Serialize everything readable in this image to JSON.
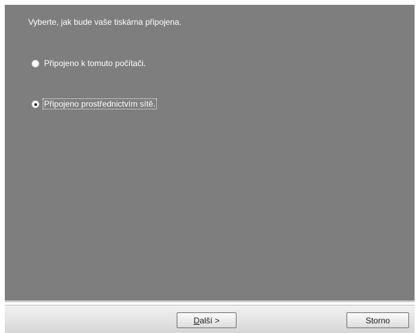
{
  "dialog": {
    "prompt": "Vyberte, jak bude vaše tiskárna připojena.",
    "options": [
      {
        "label": "Připojeno k tomuto počítači.",
        "selected": false
      },
      {
        "label": "Připojeno prostřednictvím sítě.",
        "selected": true
      }
    ]
  },
  "buttons": {
    "next_accel": "D",
    "next_rest": "alší >",
    "cancel": "Storno"
  },
  "colors": {
    "panel_background": "#7e7e7f",
    "bottom_bar": "#e3e3e3"
  }
}
